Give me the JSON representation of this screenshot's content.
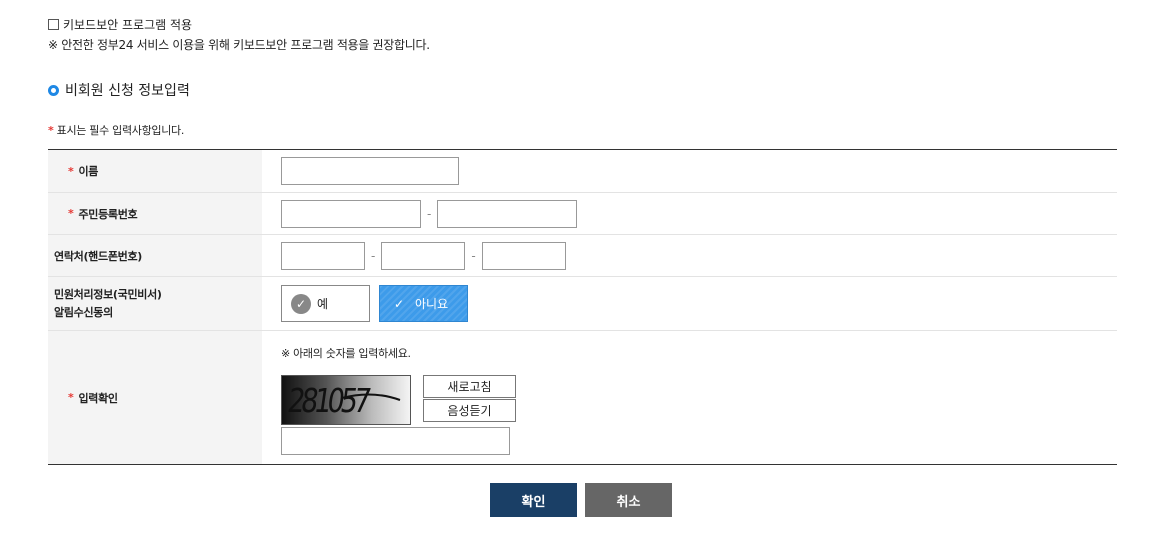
{
  "keyboard": {
    "checkbox_label": "키보드보안 프로그램 적용",
    "note": "※ 안전한 정부24 서비스 이용을 위해 키보드보안 프로그램 적용을 권장합니다."
  },
  "section": {
    "title": "비회원 신청 정보입력"
  },
  "required_note": {
    "star": "*",
    "text": " 표시는 필수 입력사항입니다."
  },
  "form": {
    "name": {
      "star": "*",
      "label": "이름",
      "value": ""
    },
    "rrn": {
      "star": "*",
      "label": "주민등록번호",
      "part1": "",
      "part2": "",
      "dash": "-"
    },
    "phone": {
      "label": "연락처(핸드폰번호)",
      "part1": "",
      "part2": "",
      "part3": "",
      "dash": "-"
    },
    "consent": {
      "label_line1": "민원처리정보(국민비서)",
      "label_line2": "알림수신동의",
      "yes": "예",
      "no": "아니요",
      "selected": "아니요"
    },
    "captcha": {
      "star": "*",
      "label": "입력확인",
      "guide": "※ 아래의 숫자를 입력하세요.",
      "image_text": "281057",
      "refresh": "새로고침",
      "audio": "음성듣기",
      "value": ""
    }
  },
  "actions": {
    "confirm": "확인",
    "cancel": "취소"
  },
  "colors": {
    "primary": "#1a3f66",
    "accent": "#3d9bea",
    "required": "#e53935",
    "cancel": "#666666"
  }
}
